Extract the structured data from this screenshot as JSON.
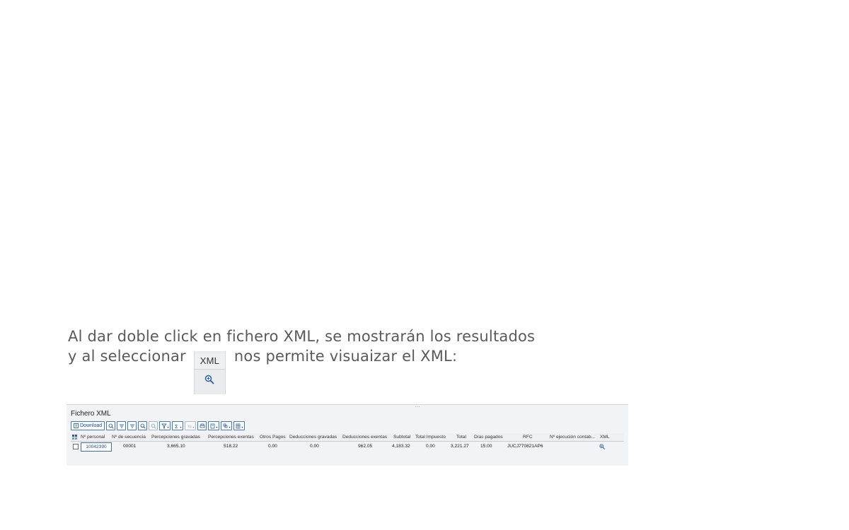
{
  "instruction": {
    "line1": "Al dar doble click en fichero XML, se mostrarán los resultados",
    "line2_before": "y al seleccionar",
    "line2_after": "nos permite visuaizar el XML:",
    "inline_column_header": "XML",
    "inline_icon": "magnifier-zoom-icon"
  },
  "sap_window": {
    "title": "Fichero XML",
    "toolbar": {
      "download_label": "Download",
      "buttons": [
        "details-icon",
        "sort-ascending-icon",
        "filter-icon",
        "find-icon",
        "find-next-icon",
        "set-filter-icon",
        "total-icon",
        "subtotal-icon",
        "print-icon",
        "export-icon",
        "change-layout-icon",
        "choose-layout-icon"
      ]
    },
    "columns": [
      "Nº personal",
      "Nº de secuencia",
      "Percepciones gravadas",
      "Percepciones exentas",
      "Otros Pagos",
      "Deducciones gravadas",
      "Deducciones exentas",
      "Subtotal",
      "Total Impuesto",
      "Total",
      "Días pagados",
      "RFC",
      "Nº ejecución contab...",
      "XML"
    ],
    "rows": [
      {
        "personal": "10042390",
        "secuencia": "00001",
        "percepciones_gravadas": "3,665.10",
        "percepciones_exentas": "518.22",
        "otros_pagos": "0.00",
        "deducciones_gravadas": "0.00",
        "deducciones_exentas": "962.05",
        "subtotal": "4,183.32",
        "total_impuesto": "0.00",
        "total": "3,221.27",
        "dias_pagados": "15.00",
        "rfc": "JUCJ770821AP6",
        "ejecucion_contab": "",
        "xml_icon": "magnifier-zoom-icon"
      }
    ]
  },
  "colors": {
    "instruction_text": "#5a5a5a",
    "sap_background": "#f2f3f4",
    "sap_accent": "#1e4f8f"
  }
}
